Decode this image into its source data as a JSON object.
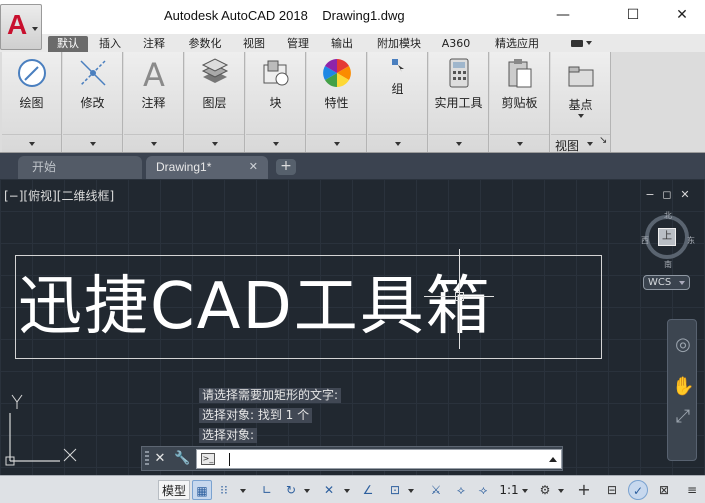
{
  "app": {
    "title": "Autodesk AutoCAD 2018    Drawing1.dwg",
    "logo_letter": "A",
    "window_controls": {
      "minimize": "—",
      "maximize": "☐",
      "close": "✕"
    }
  },
  "ribbon_tabs": [
    {
      "label": "默认",
      "active": true
    },
    {
      "label": "插入"
    },
    {
      "label": "注释"
    },
    {
      "label": "参数化"
    },
    {
      "label": "视图"
    },
    {
      "label": "管理"
    },
    {
      "label": "输出"
    },
    {
      "label": "附加模块"
    },
    {
      "label": "A360"
    },
    {
      "label": "精选应用"
    }
  ],
  "ribbon_panels": {
    "draw": "绘图",
    "modify": "修改",
    "annotate": "注释",
    "layers": "图层",
    "block": "块",
    "properties": "特性",
    "groups": "组",
    "utilities": "实用工具",
    "clipboard": "剪贴板",
    "basepoint": "基点",
    "view": "视图"
  },
  "file_tabs": {
    "home": "开始",
    "doc": "Drawing1*",
    "close": "✕",
    "add": "+"
  },
  "viewport": {
    "label": "[−][俯视][二维线框]",
    "controls": {
      "minimize": "−",
      "restore": "◻",
      "close": "✕"
    },
    "text": "迅捷CAD工具箱",
    "compass": {
      "north": "北",
      "south": "南",
      "east": "东",
      "west": "西",
      "top": "上"
    },
    "wcs": "WCS",
    "ucs": {
      "x": "X",
      "y": "Y"
    }
  },
  "command_history": [
    "请选择需要加矩形的文字:",
    "选择对象: 找到 1 个",
    "选择对象:"
  ],
  "command_line": {
    "close": "✕",
    "customize": "🔧",
    "prompt_icon": ">_"
  },
  "statusbar": {
    "model": "模型",
    "grid": "▦",
    "snap": "⁝⁝",
    "ortho": "∟",
    "polar": "↻",
    "osnap": "⊡",
    "annotation_scale": "1:1",
    "settings": "⚙",
    "plus": "+",
    "menu": "≡"
  },
  "colors": {
    "canvas": "#212830",
    "ribbon": "#dcdcdc",
    "accent": "#2d5f9e",
    "brand_red": "#c8102e"
  }
}
